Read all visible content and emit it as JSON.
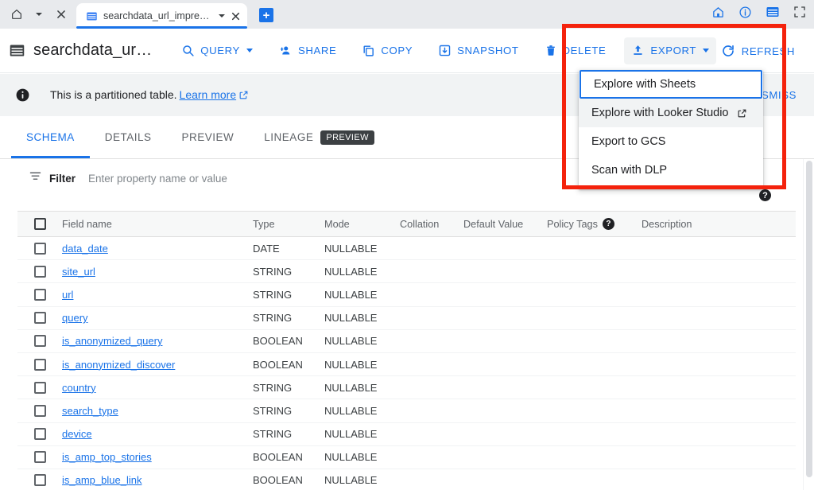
{
  "browser": {
    "home_icon": "home-icon",
    "dropdown_icon": "chevron-down-icon",
    "close_icon": "close-icon",
    "tab": {
      "favicon": "table-grid-icon",
      "title": "searchdata_url_impression",
      "caret": "chevron-down-icon",
      "close": "close-icon"
    },
    "new_tab_label": "+",
    "right_icons": [
      "home-icon",
      "info-icon",
      "table-grid-icon",
      "fullscreen-icon"
    ]
  },
  "toolbar": {
    "dataset_icon": "table-grid-icon",
    "title": "searchdata_ur…",
    "buttons": [
      {
        "label": "QUERY",
        "icon": "search-icon",
        "caret": true
      },
      {
        "label": "SHARE",
        "icon": "person-add-icon",
        "caret": false
      },
      {
        "label": "COPY",
        "icon": "copy-icon",
        "caret": false
      },
      {
        "label": "SNAPSHOT",
        "icon": "snapshot-icon",
        "caret": false
      },
      {
        "label": "DELETE",
        "icon": "trash-icon",
        "caret": false
      },
      {
        "label": "EXPORT",
        "icon": "upload-icon",
        "caret": true
      }
    ],
    "refresh_label": "REFRESH",
    "refresh_icon": "refresh-icon"
  },
  "banner": {
    "icon": "info-icon",
    "text": "This is a partitioned table.",
    "link": "Learn more",
    "link_icon": "external-link-icon",
    "dismiss_label": "DISMISS"
  },
  "tabs": [
    {
      "label": "SCHEMA",
      "selected": true
    },
    {
      "label": "DETAILS",
      "selected": false
    },
    {
      "label": "PREVIEW",
      "selected": false
    },
    {
      "label": "LINEAGE",
      "selected": false,
      "chip": "PREVIEW"
    }
  ],
  "filter": {
    "icon": "filter-icon",
    "label": "Filter",
    "placeholder": "Enter property name or value",
    "help_icon": "help-icon",
    "help_glyph": "?"
  },
  "schema_table": {
    "columns": [
      "Field name",
      "Type",
      "Mode",
      "Collation",
      "Default Value",
      "Policy Tags",
      "Description"
    ],
    "policy_tags_help": "?",
    "rows": [
      {
        "field": "data_date",
        "type": "DATE",
        "mode": "NULLABLE",
        "collation": "",
        "default": "",
        "policy": "",
        "description": ""
      },
      {
        "field": "site_url",
        "type": "STRING",
        "mode": "NULLABLE",
        "collation": "",
        "default": "",
        "policy": "",
        "description": ""
      },
      {
        "field": "url",
        "type": "STRING",
        "mode": "NULLABLE",
        "collation": "",
        "default": "",
        "policy": "",
        "description": ""
      },
      {
        "field": "query",
        "type": "STRING",
        "mode": "NULLABLE",
        "collation": "",
        "default": "",
        "policy": "",
        "description": ""
      },
      {
        "field": "is_anonymized_query",
        "type": "BOOLEAN",
        "mode": "NULLABLE",
        "collation": "",
        "default": "",
        "policy": "",
        "description": ""
      },
      {
        "field": "is_anonymized_discover",
        "type": "BOOLEAN",
        "mode": "NULLABLE",
        "collation": "",
        "default": "",
        "policy": "",
        "description": ""
      },
      {
        "field": "country",
        "type": "STRING",
        "mode": "NULLABLE",
        "collation": "",
        "default": "",
        "policy": "",
        "description": ""
      },
      {
        "field": "search_type",
        "type": "STRING",
        "mode": "NULLABLE",
        "collation": "",
        "default": "",
        "policy": "",
        "description": ""
      },
      {
        "field": "device",
        "type": "STRING",
        "mode": "NULLABLE",
        "collation": "",
        "default": "",
        "policy": "",
        "description": ""
      },
      {
        "field": "is_amp_top_stories",
        "type": "BOOLEAN",
        "mode": "NULLABLE",
        "collation": "",
        "default": "",
        "policy": "",
        "description": ""
      },
      {
        "field": "is_amp_blue_link",
        "type": "BOOLEAN",
        "mode": "NULLABLE",
        "collation": "",
        "default": "",
        "policy": "",
        "description": ""
      }
    ]
  },
  "export_menu": {
    "items": [
      {
        "label": "Explore with Sheets",
        "focused": true,
        "external": false
      },
      {
        "label": "Explore with Looker Studio",
        "focused": false,
        "external": true,
        "ext_icon": "external-link-icon"
      },
      {
        "label": "Export to GCS",
        "focused": false,
        "external": false
      },
      {
        "label": "Scan with DLP",
        "focused": false,
        "external": false
      }
    ]
  },
  "annotation": {
    "color": "#f4220c",
    "name": "export-menu-highlight"
  },
  "colors": {
    "accent": "#1a73e8",
    "banner_bg": "#f1f3f4",
    "chip_bg": "#3c4043",
    "annotation": "#f4220c"
  }
}
